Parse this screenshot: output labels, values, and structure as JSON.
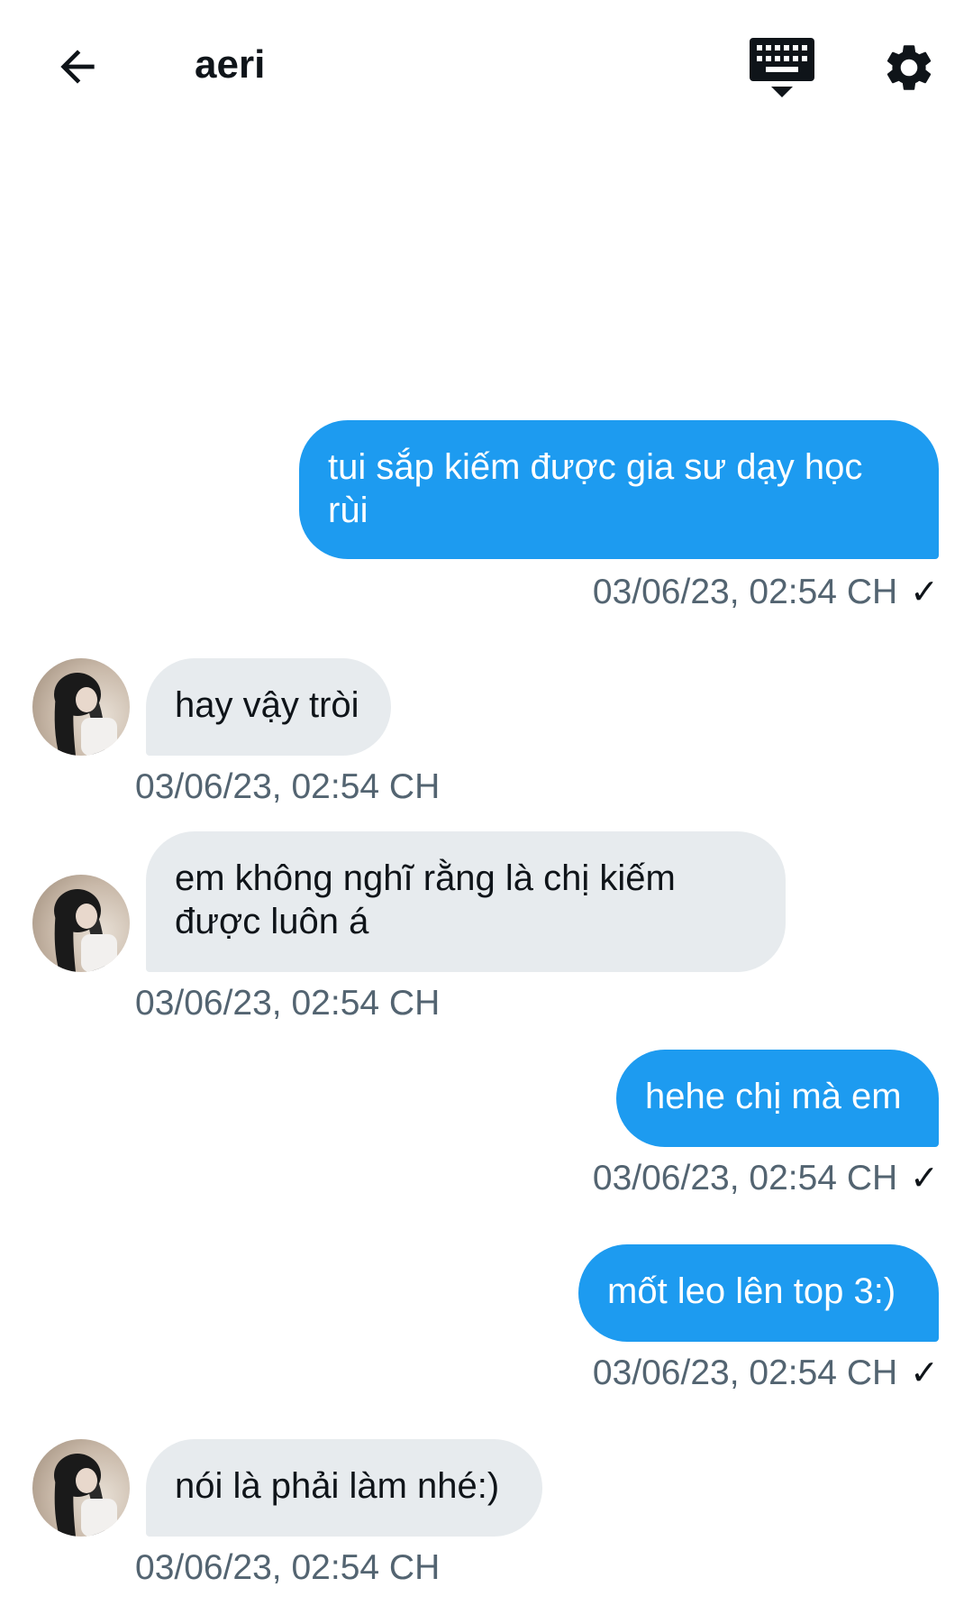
{
  "header": {
    "title": "aeri",
    "back_icon": "arrow-left-icon",
    "keyboard_icon": "keyboard-icon",
    "settings_icon": "gear-icon"
  },
  "colors": {
    "outgoing_bubble": "#1d9bf0",
    "incoming_bubble": "#e7ebee",
    "timestamp": "#536471"
  },
  "messages": [
    {
      "direction": "outgoing",
      "text": "tui sắp kiếm được gia sư dạy học rùi",
      "time": "03/06/23, 02:54 CH",
      "read_mark": "✓"
    },
    {
      "direction": "incoming",
      "text": "hay vậy tròi",
      "time": "03/06/23, 02:54 CH"
    },
    {
      "direction": "incoming",
      "text": "em không nghĩ rằng là chị kiếm được luôn á",
      "time": "03/06/23, 02:54 CH"
    },
    {
      "direction": "outgoing",
      "text": "hehe chị mà em",
      "time": "03/06/23, 02:54 CH",
      "read_mark": "✓"
    },
    {
      "direction": "outgoing",
      "text": "mốt leo lên top 3:)",
      "time": "03/06/23, 02:54 CH",
      "read_mark": "✓"
    },
    {
      "direction": "incoming",
      "text": "nói là phải làm nhé:)",
      "time": "03/06/23, 02:54 CH"
    }
  ]
}
